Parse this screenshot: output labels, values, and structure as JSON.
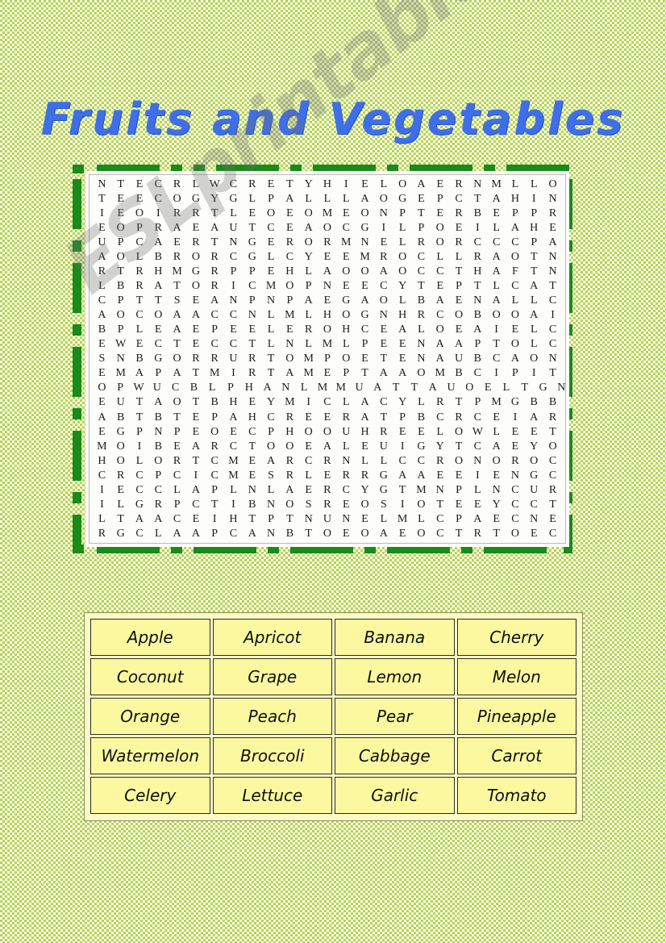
{
  "page": {
    "title": "Fruits and Vegetables",
    "background_color": "#b5d44a",
    "accent_color": "#1a8a1a",
    "title_color": "#3f6fe8",
    "word_cell_color": "#fbf8a0"
  },
  "watermark": {
    "text": "ESLprintables.com"
  },
  "puzzle": {
    "columns": 25,
    "rows": 25,
    "grid": [
      [
        "N",
        "T",
        "E",
        "C",
        "R",
        "L",
        "W",
        "C",
        "R",
        "E",
        "T",
        "Y",
        "H",
        "I",
        "E",
        "L",
        "O",
        "A",
        "E",
        "R",
        "N",
        "M",
        "L",
        "L",
        "O"
      ],
      [
        "T",
        "E",
        "E",
        "C",
        "O",
        "G",
        "Y",
        "G",
        "L",
        "P",
        "A",
        "L",
        "L",
        "L",
        "A",
        "O",
        "G",
        "E",
        "P",
        "C",
        "T",
        "A",
        "H",
        "I",
        "N"
      ],
      [
        "I",
        "E",
        "O",
        "I",
        "R",
        "R",
        "T",
        "L",
        "E",
        "O",
        "E",
        "O",
        "M",
        "E",
        "O",
        "N",
        "P",
        "T",
        "E",
        "R",
        "B",
        "E",
        "P",
        "P",
        "R"
      ],
      [
        "E",
        "O",
        "P",
        "R",
        "A",
        "E",
        "A",
        "U",
        "T",
        "C",
        "E",
        "A",
        "O",
        "C",
        "G",
        "I",
        "L",
        "P",
        "O",
        "E",
        "I",
        "L",
        "A",
        "H",
        "E"
      ],
      [
        "U",
        "P",
        "C",
        "A",
        "E",
        "R",
        "T",
        "N",
        "G",
        "E",
        "R",
        "O",
        "R",
        "M",
        "N",
        "E",
        "L",
        "R",
        "O",
        "R",
        "C",
        "C",
        "C",
        "P",
        "A"
      ],
      [
        "A",
        "O",
        "L",
        "B",
        "R",
        "O",
        "R",
        "C",
        "G",
        "L",
        "C",
        "Y",
        "E",
        "E",
        "M",
        "R",
        "O",
        "C",
        "L",
        "L",
        "R",
        "A",
        "O",
        "T",
        "N"
      ],
      [
        "R",
        "T",
        "R",
        "H",
        "M",
        "G",
        "R",
        "P",
        "P",
        "E",
        "H",
        "L",
        "A",
        "O",
        "O",
        "A",
        "O",
        "C",
        "C",
        "T",
        "H",
        "A",
        "F",
        "T",
        "N"
      ],
      [
        "L",
        "B",
        "R",
        "A",
        "T",
        "O",
        "R",
        "I",
        "C",
        "M",
        "O",
        "P",
        "N",
        "E",
        "E",
        "C",
        "Y",
        "T",
        "E",
        "P",
        "T",
        "L",
        "C",
        "A",
        "T"
      ],
      [
        "C",
        "P",
        "T",
        "T",
        "S",
        "E",
        "A",
        "N",
        "P",
        "N",
        "P",
        "A",
        "E",
        "G",
        "A",
        "O",
        "L",
        "B",
        "A",
        "E",
        "N",
        "A",
        "L",
        "L",
        "C"
      ],
      [
        "A",
        "O",
        "C",
        "O",
        "A",
        "A",
        "C",
        "C",
        "N",
        "L",
        "M",
        "L",
        "H",
        "O",
        "G",
        "N",
        "H",
        "R",
        "C",
        "O",
        "B",
        "O",
        "O",
        "A",
        "I"
      ],
      [
        "B",
        "P",
        "L",
        "E",
        "A",
        "E",
        "P",
        "E",
        "E",
        "L",
        "E",
        "R",
        "O",
        "H",
        "C",
        "E",
        "A",
        "L",
        "O",
        "E",
        "A",
        "I",
        "E",
        "L",
        "C"
      ],
      [
        "E",
        "W",
        "E",
        "C",
        "T",
        "E",
        "C",
        "C",
        "T",
        "L",
        "N",
        "L",
        "M",
        "L",
        "P",
        "E",
        "E",
        "N",
        "A",
        "A",
        "P",
        "T",
        "O",
        "L",
        "C"
      ],
      [
        "S",
        "N",
        "B",
        "G",
        "O",
        "R",
        "R",
        "U",
        "R",
        "T",
        "O",
        "M",
        "P",
        "O",
        "E",
        "T",
        "E",
        "N",
        "A",
        "U",
        "B",
        "C",
        "A",
        "O",
        "N"
      ],
      [
        "E",
        "M",
        "A",
        "P",
        "A",
        "T",
        "M",
        "I",
        "R",
        "T",
        "A",
        "M",
        "E",
        "P",
        "T",
        "A",
        "A",
        "O",
        "M",
        "B",
        "C",
        "I",
        "P",
        "I",
        "T"
      ],
      [
        "O",
        "P",
        "W",
        "U",
        "C",
        "B",
        "L",
        "P",
        "H",
        "A",
        "N",
        "L",
        "M",
        "M",
        "U",
        "A",
        "T",
        "T",
        "A",
        "U",
        "O",
        "E",
        "L",
        "T",
        "G",
        "N"
      ],
      [
        "E",
        "U",
        "T",
        "A",
        "O",
        "T",
        "B",
        "H",
        "E",
        "Y",
        "M",
        "I",
        "C",
        "L",
        "A",
        "C",
        "Y",
        "L",
        "R",
        "T",
        "P",
        "M",
        "G",
        "B",
        "B"
      ],
      [
        "A",
        "B",
        "T",
        "B",
        "T",
        "E",
        "P",
        "A",
        "H",
        "C",
        "R",
        "E",
        "E",
        "R",
        "A",
        "T",
        "P",
        "B",
        "C",
        "R",
        "C",
        "E",
        "I",
        "A",
        "R"
      ],
      [
        "E",
        "G",
        "P",
        "N",
        "P",
        "E",
        "O",
        "E",
        "C",
        "P",
        "H",
        "O",
        "O",
        "U",
        "H",
        "R",
        "E",
        "E",
        "L",
        "O",
        "W",
        "L",
        "E",
        "E",
        "T"
      ],
      [
        "M",
        "O",
        "I",
        "B",
        "E",
        "A",
        "R",
        "C",
        "T",
        "O",
        "O",
        "E",
        "A",
        "L",
        "E",
        "U",
        "I",
        "G",
        "Y",
        "T",
        "C",
        "A",
        "E",
        "Y",
        "O"
      ],
      [
        "H",
        "O",
        "L",
        "O",
        "R",
        "T",
        "C",
        "M",
        "E",
        "A",
        "R",
        "C",
        "R",
        "N",
        "L",
        "L",
        "C",
        "C",
        "R",
        "O",
        "N",
        "O",
        "R",
        "O",
        "C"
      ],
      [
        "C",
        "R",
        "C",
        "P",
        "C",
        "I",
        "C",
        "M",
        "E",
        "S",
        "R",
        "L",
        "E",
        "R",
        "R",
        "G",
        "A",
        "A",
        "E",
        "E",
        "I",
        "E",
        "N",
        "G",
        "C"
      ],
      [
        "I",
        "E",
        "C",
        "C",
        "L",
        "A",
        "P",
        "L",
        "N",
        "L",
        "A",
        "E",
        "R",
        "C",
        "Y",
        "G",
        "T",
        "M",
        "N",
        "P",
        "L",
        "N",
        "C",
        "U",
        "R"
      ],
      [
        "I",
        "L",
        "G",
        "R",
        "P",
        "C",
        "T",
        "I",
        "B",
        "N",
        "O",
        "S",
        "R",
        "E",
        "O",
        "S",
        "I",
        "O",
        "T",
        "E",
        "E",
        "Y",
        "C",
        "C",
        "T"
      ],
      [
        "L",
        "T",
        "A",
        "A",
        "C",
        "E",
        "I",
        "H",
        "T",
        "P",
        "T",
        "N",
        "U",
        "N",
        "E",
        "L",
        "M",
        "L",
        "C",
        "P",
        "A",
        "E",
        "C",
        "N",
        "E"
      ],
      [
        "R",
        "G",
        "C",
        "L",
        "A",
        "A",
        "P",
        "C",
        "A",
        "N",
        "B",
        "T",
        "O",
        "E",
        "O",
        "A",
        "E",
        "O",
        "C",
        "T",
        "R",
        "T",
        "O",
        "E",
        "C"
      ]
    ]
  },
  "word_list": {
    "rows": [
      [
        "Apple",
        "Apricot",
        "Banana",
        "Cherry"
      ],
      [
        "Coconut",
        "Grape",
        "Lemon",
        "Melon"
      ],
      [
        "Orange",
        "Peach",
        "Pear",
        "Pineapple"
      ],
      [
        "Watermelon",
        "Broccoli",
        "Cabbage",
        "Carrot"
      ],
      [
        "Celery",
        "Lettuce",
        "Garlic",
        "Tomato"
      ]
    ]
  }
}
